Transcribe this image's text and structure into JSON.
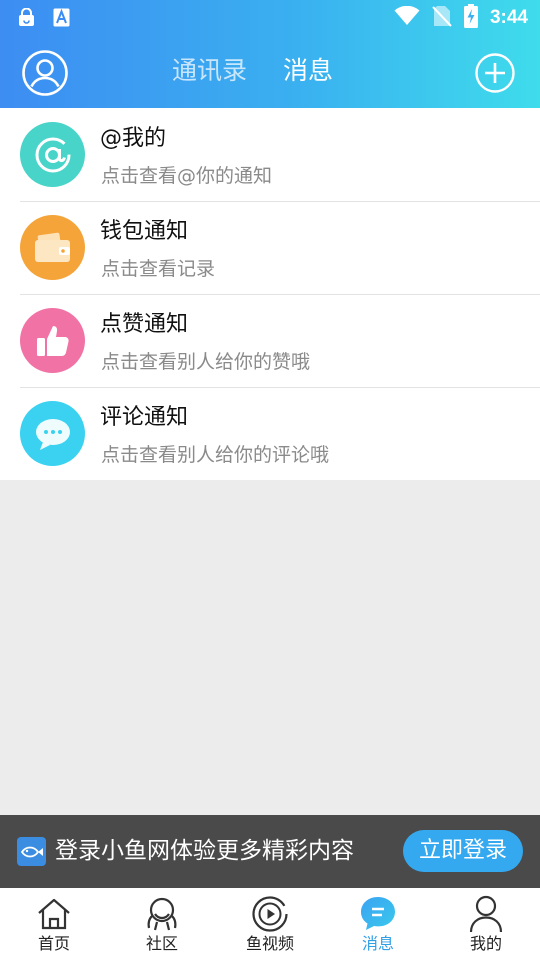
{
  "status_bar": {
    "time": "3:44",
    "left_icons": [
      "lock-app-icon",
      "text-a-icon"
    ],
    "right_icons": [
      "wifi-icon",
      "no-sim-icon",
      "battery-charging-icon"
    ]
  },
  "header": {
    "tabs": [
      {
        "label": "通讯录",
        "active": false
      },
      {
        "label": "消息",
        "active": true
      }
    ],
    "left_icon": "user-icon",
    "right_icon": "plus-icon"
  },
  "messages": [
    {
      "title": "@我的",
      "subtitle": "点击查看@你的通知",
      "icon": "at-icon",
      "color": "#47d6c9"
    },
    {
      "title": "钱包通知",
      "subtitle": "点击查看记录",
      "icon": "wallet-icon",
      "color": "#f5a43a"
    },
    {
      "title": "点赞通知",
      "subtitle": "点击查看别人给你的赞哦",
      "icon": "thumbs-up-icon",
      "color": "#f173a6"
    },
    {
      "title": "评论通知",
      "subtitle": "点击查看别人给你的评论哦",
      "icon": "comment-icon",
      "color": "#3ad2f0"
    }
  ],
  "banner": {
    "text": "登录小鱼网体验更多精彩内容",
    "button": "立即登录",
    "logo_icon": "fish-logo-icon"
  },
  "tabbar": [
    {
      "label": "首页",
      "icon": "home-icon",
      "active": false
    },
    {
      "label": "社区",
      "icon": "community-icon",
      "active": false
    },
    {
      "label": "鱼视频",
      "icon": "video-play-icon",
      "active": false
    },
    {
      "label": "消息",
      "icon": "message-icon",
      "active": true
    },
    {
      "label": "我的",
      "icon": "profile-icon",
      "active": false
    }
  ],
  "colors": {
    "accent": "#2f9fe6",
    "header_gradient_start": "#3d8df2",
    "header_gradient_end": "#3fdcec"
  }
}
